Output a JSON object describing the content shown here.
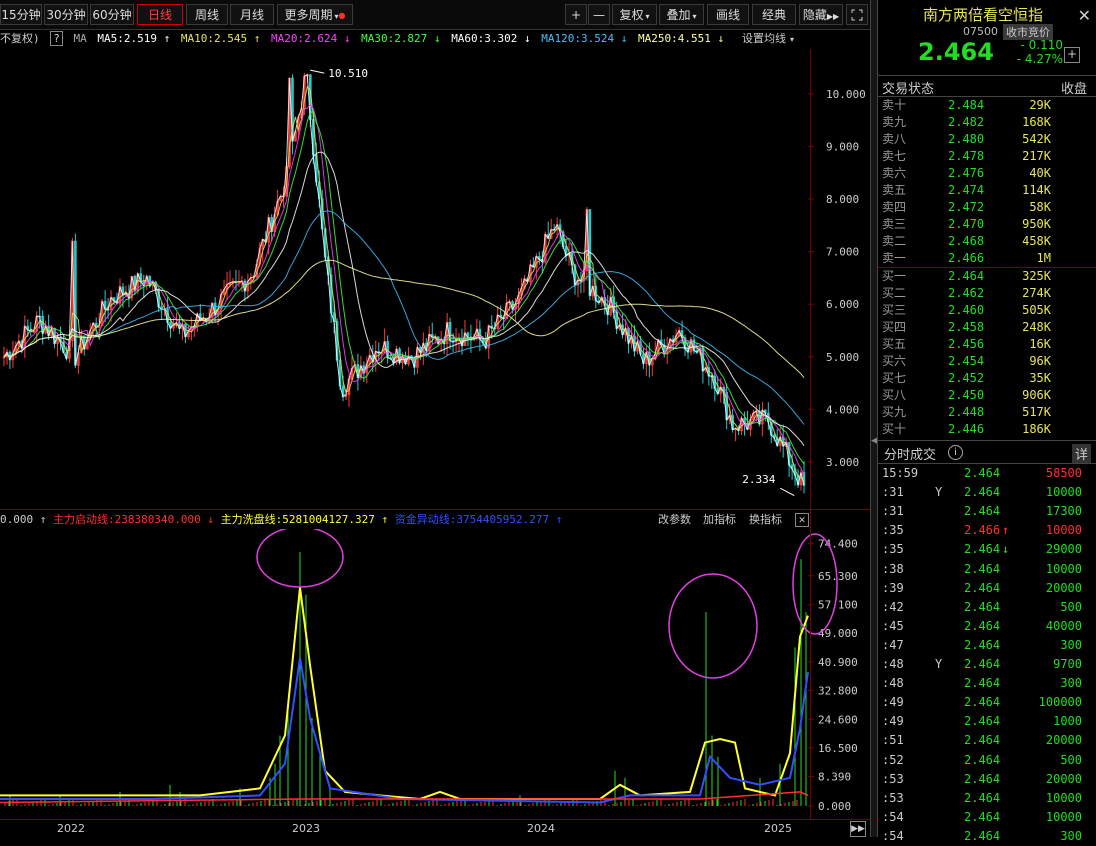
{
  "toolbar": {
    "periods": [
      "15分钟",
      "30分钟",
      "60分钟",
      "日线",
      "周线",
      "月线",
      "更多周期"
    ],
    "active_period": "日线",
    "right_buttons": [
      "+",
      "—",
      "复权",
      "叠加",
      "画线",
      "经典",
      "隐藏"
    ],
    "fullscreen_icon": "fullscreen-icon"
  },
  "ma_bar": {
    "adjust": "不复权)",
    "help": "?",
    "ma": "MA",
    "ma5": "MA5:2.519 ↑",
    "ma10": "MA10:2.545 ↑",
    "ma20": "MA20:2.624 ↓",
    "ma30": "MA30:2.827 ↓",
    "ma60": "MA60:3.302 ↓",
    "ma120": "MA120:3.524 ↓",
    "ma250": "MA250:4.551 ↓",
    "settings": "设置均线",
    "colors": {
      "ma5": "#ffffff",
      "ma10": "#e6e65a",
      "ma20": "#ff40ff",
      "ma30": "#40ff40",
      "ma60": "#ffffff",
      "ma120": "#40c0ff",
      "ma250": "#ffffa0"
    }
  },
  "sub_bar": {
    "prefix": "0.000 ↑",
    "line1": "主力启动线:238380340.000 ↓",
    "line2": "主力洗盘线:5281004127.327 ↑",
    "line3": "资金异动线:3754405952.277 ↑",
    "btn_params": "改参数",
    "btn_add": "加指标",
    "btn_swap": "换指标",
    "close_icon": "close-icon",
    "colors": {
      "line1": "#ff3030",
      "line2": "#ffff30",
      "line3": "#3050ff"
    }
  },
  "chart_data": [
    {
      "type": "candlestick",
      "price_axis_ticks": [
        "10.000",
        "9.000",
        "8.000",
        "7.000",
        "6.000",
        "5.000",
        "4.000",
        "3.000"
      ],
      "ylim": [
        2.2,
        10.7
      ],
      "annotations": {
        "high": "10.510",
        "low": "2.334"
      },
      "close_series": [
        {
          "x": "2021-06",
          "y": 5.0
        },
        {
          "x": "2021-08",
          "y": 5.7
        },
        {
          "x": "2021-10",
          "y": 5.0
        },
        {
          "x": "2021-12",
          "y": 6.1
        },
        {
          "x": "2022-02",
          "y": 6.5
        },
        {
          "x": "2022-04",
          "y": 5.4
        },
        {
          "x": "2022-06",
          "y": 6.0
        },
        {
          "x": "2022-08",
          "y": 6.6
        },
        {
          "x": "2022-10",
          "y": 8.5
        },
        {
          "x": "2022-11",
          "y": 10.4
        },
        {
          "x": "2022-12",
          "y": 7.0
        },
        {
          "x": "2023-01",
          "y": 4.4
        },
        {
          "x": "2023-03",
          "y": 5.2
        },
        {
          "x": "2023-05",
          "y": 5.0
        },
        {
          "x": "2023-07",
          "y": 5.5
        },
        {
          "x": "2023-09",
          "y": 5.3
        },
        {
          "x": "2023-11",
          "y": 6.1
        },
        {
          "x": "2024-01",
          "y": 7.5
        },
        {
          "x": "2024-02",
          "y": 6.6
        },
        {
          "x": "2024-04",
          "y": 6.0
        },
        {
          "x": "2024-06",
          "y": 4.9
        },
        {
          "x": "2024-08",
          "y": 5.5
        },
        {
          "x": "2024-10",
          "y": 4.6
        },
        {
          "x": "2024-11",
          "y": 3.7
        },
        {
          "x": "2025-01",
          "y": 3.8
        },
        {
          "x": "2025-03",
          "y": 2.5
        }
      ]
    },
    {
      "type": "line",
      "indicator_axis_ticks": [
        "74.400",
        "65.300",
        "57.100",
        "49.000",
        "40.900",
        "32.800",
        "24.600",
        "16.500",
        "8.390",
        "0.000"
      ],
      "ylim": [
        0,
        78
      ]
    }
  ],
  "date_axis": [
    "2022",
    "2023",
    "2024",
    "2025"
  ],
  "panel": {
    "name": "南方两倍看空恒指",
    "code": "07500",
    "auction": "收市竞价",
    "price": "2.464",
    "change": "- 0.110",
    "change_pct": "- 4.27%",
    "trade_status": "交易状态",
    "close_label": "收盘",
    "asks": [
      {
        "label": "卖十",
        "price": "2.484",
        "vol": "29K"
      },
      {
        "label": "卖九",
        "price": "2.482",
        "vol": "168K"
      },
      {
        "label": "卖八",
        "price": "2.480",
        "vol": "542K"
      },
      {
        "label": "卖七",
        "price": "2.478",
        "vol": "217K"
      },
      {
        "label": "卖六",
        "price": "2.476",
        "vol": "40K"
      },
      {
        "label": "卖五",
        "price": "2.474",
        "vol": "114K"
      },
      {
        "label": "卖四",
        "price": "2.472",
        "vol": "58K"
      },
      {
        "label": "卖三",
        "price": "2.470",
        "vol": "950K"
      },
      {
        "label": "卖二",
        "price": "2.468",
        "vol": "458K"
      },
      {
        "label": "卖一",
        "price": "2.466",
        "vol": "1M"
      }
    ],
    "bids": [
      {
        "label": "买一",
        "price": "2.464",
        "vol": "325K"
      },
      {
        "label": "买二",
        "price": "2.462",
        "vol": "274K"
      },
      {
        "label": "买三",
        "price": "2.460",
        "vol": "505K"
      },
      {
        "label": "买四",
        "price": "2.458",
        "vol": "248K"
      },
      {
        "label": "买五",
        "price": "2.456",
        "vol": "16K"
      },
      {
        "label": "买六",
        "price": "2.454",
        "vol": "96K"
      },
      {
        "label": "买七",
        "price": "2.452",
        "vol": "35K"
      },
      {
        "label": "买八",
        "price": "2.450",
        "vol": "906K"
      },
      {
        "label": "买九",
        "price": "2.448",
        "vol": "517K"
      },
      {
        "label": "买十",
        "price": "2.446",
        "vol": "186K"
      }
    ],
    "ticks_title": "分时成交",
    "info": "i",
    "detail": "详",
    "ticks": [
      {
        "t": "15:59",
        "f": "",
        "p": "2.464",
        "a": "",
        "v": "58500",
        "vc": "#ff3030"
      },
      {
        "t": ":31",
        "f": "Y",
        "p": "2.464",
        "a": "",
        "v": "10000",
        "vc": "#22dd22"
      },
      {
        "t": ":31",
        "f": "",
        "p": "2.464",
        "a": "",
        "v": "17300",
        "vc": "#22dd22"
      },
      {
        "t": ":35",
        "f": "",
        "p": "2.466",
        "a": "↑",
        "v": "10000",
        "vc": "#ff3030",
        "pc": "#ff3030"
      },
      {
        "t": ":35",
        "f": "",
        "p": "2.464",
        "a": "↓",
        "v": "29000",
        "vc": "#22dd22"
      },
      {
        "t": ":38",
        "f": "",
        "p": "2.464",
        "a": "",
        "v": "10000",
        "vc": "#22dd22"
      },
      {
        "t": ":39",
        "f": "",
        "p": "2.464",
        "a": "",
        "v": "20000",
        "vc": "#22dd22"
      },
      {
        "t": ":42",
        "f": "",
        "p": "2.464",
        "a": "",
        "v": "500",
        "vc": "#22dd22"
      },
      {
        "t": ":45",
        "f": "",
        "p": "2.464",
        "a": "",
        "v": "40000",
        "vc": "#22dd22"
      },
      {
        "t": ":47",
        "f": "",
        "p": "2.464",
        "a": "",
        "v": "300",
        "vc": "#22dd22"
      },
      {
        "t": ":48",
        "f": "Y",
        "p": "2.464",
        "a": "",
        "v": "9700",
        "vc": "#22dd22"
      },
      {
        "t": ":48",
        "f": "",
        "p": "2.464",
        "a": "",
        "v": "300",
        "vc": "#22dd22"
      },
      {
        "t": ":49",
        "f": "",
        "p": "2.464",
        "a": "",
        "v": "100000",
        "vc": "#22dd22"
      },
      {
        "t": ":49",
        "f": "",
        "p": "2.464",
        "a": "",
        "v": "1000",
        "vc": "#22dd22"
      },
      {
        "t": ":51",
        "f": "",
        "p": "2.464",
        "a": "",
        "v": "20000",
        "vc": "#22dd22"
      },
      {
        "t": ":52",
        "f": "",
        "p": "2.464",
        "a": "",
        "v": "500",
        "vc": "#22dd22"
      },
      {
        "t": ":53",
        "f": "",
        "p": "2.464",
        "a": "",
        "v": "20000",
        "vc": "#22dd22"
      },
      {
        "t": ":53",
        "f": "",
        "p": "2.464",
        "a": "",
        "v": "10000",
        "vc": "#22dd22"
      },
      {
        "t": ":54",
        "f": "",
        "p": "2.464",
        "a": "",
        "v": "10000",
        "vc": "#22dd22"
      },
      {
        "t": ":54",
        "f": "",
        "p": "2.464",
        "a": "",
        "v": "300",
        "vc": "#22dd22"
      }
    ]
  }
}
